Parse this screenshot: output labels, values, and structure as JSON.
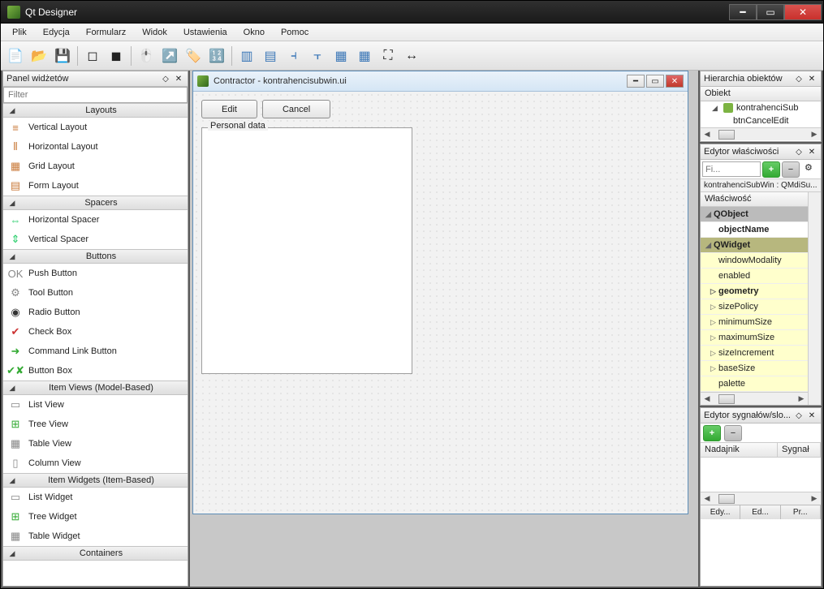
{
  "app_title": "Qt Designer",
  "menu": [
    "Plik",
    "Edycja",
    "Formularz",
    "Widok",
    "Ustawienia",
    "Okno",
    "Pomoc"
  ],
  "widgetbox": {
    "title": "Panel widżetów",
    "filter_placeholder": "Filter",
    "groups": [
      {
        "name": "Layouts",
        "items": [
          "Vertical Layout",
          "Horizontal Layout",
          "Grid Layout",
          "Form Layout"
        ]
      },
      {
        "name": "Spacers",
        "items": [
          "Horizontal Spacer",
          "Vertical Spacer"
        ]
      },
      {
        "name": "Buttons",
        "items": [
          "Push Button",
          "Tool Button",
          "Radio Button",
          "Check Box",
          "Command Link Button",
          "Button Box"
        ]
      },
      {
        "name": "Item Views (Model-Based)",
        "items": [
          "List View",
          "Tree View",
          "Table View",
          "Column View"
        ]
      },
      {
        "name": "Item Widgets (Item-Based)",
        "items": [
          "List Widget",
          "Tree Widget",
          "Table Widget"
        ]
      },
      {
        "name": "Containers",
        "items": []
      }
    ]
  },
  "form": {
    "window_title": "Contractor - kontrahencisubwin.ui",
    "btn_edit": "Edit",
    "btn_cancel": "Cancel",
    "group_label": "Personal data"
  },
  "object_inspector": {
    "title": "Hierarchia obiektów",
    "column": "Obiekt",
    "rows": [
      "kontrahenciSub",
      "btnCancelEdit"
    ]
  },
  "property_editor": {
    "title": "Edytor właściwości",
    "filter_placeholder": "Fi...",
    "context": "kontrahenciSubWin : QMdiSu...",
    "header": "Właściwość",
    "rows": [
      {
        "t": "QObject",
        "section": true
      },
      {
        "t": "objectName",
        "bold": true
      },
      {
        "t": "QWidget",
        "section": true,
        "alt": true
      },
      {
        "t": "windowModality",
        "alt": true
      },
      {
        "t": "enabled",
        "alt": true
      },
      {
        "t": "geometry",
        "alt": true,
        "bold": true,
        "exp": true
      },
      {
        "t": "sizePolicy",
        "alt": true,
        "exp": true
      },
      {
        "t": "minimumSize",
        "alt": true,
        "exp": true
      },
      {
        "t": "maximumSize",
        "alt": true,
        "exp": true
      },
      {
        "t": "sizeIncrement",
        "alt": true,
        "exp": true
      },
      {
        "t": "baseSize",
        "alt": true,
        "exp": true
      },
      {
        "t": "palette",
        "alt": true
      }
    ]
  },
  "signal_editor": {
    "title": "Edytor sygnałów/slo...",
    "col1": "Nadajnik",
    "col2": "Sygnał",
    "tabs": [
      "Edy...",
      "Ed...",
      "Pr..."
    ]
  }
}
